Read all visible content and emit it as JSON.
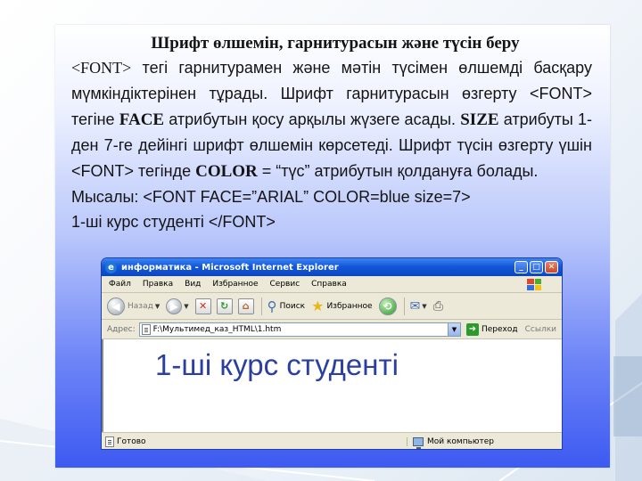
{
  "slide": {
    "title": "Шрифт өлшемін, гарнитурасын және түсін беру",
    "para_parts": [
      "<FONT>",
      " тегі гарнитурамен  және мәтін  түсімен  өлшемді басқару мүмкіндіктерінен  тұрады.  Шрифт  гарнитурасын өзгерту  <FONT>  тегіне ",
      "FACE",
      "  атрибутын  қосу  арқылы жүзеге  асады. ",
      "SIZE",
      "  атрибуты 1-ден  7-ге  дейінгі  шрифт өлшемін  көрсетеді.  Шрифт  түсін  өзгерту  үшін <FONT> тегінде ",
      "COLOR",
      " = “түс” атрибутын қолдануға болады."
    ],
    "example_line": "Мысалы: <FONT FACE=”ARIAL”   COLOR=blue size=7>",
    "example_line2": "1-ші курс студенті   </FONT>"
  },
  "browser": {
    "title": "информатика - Microsoft Internet Explorer",
    "menu": [
      "Файл",
      "Правка",
      "Вид",
      "Избранное",
      "Сервис",
      "Справка"
    ],
    "toolbar": {
      "back": "Назад",
      "search": "Поиск",
      "favorites": "Избранное"
    },
    "address": {
      "label": "Адрес:",
      "value": "F:\\Мультимед_каз_HTML\\1.htm",
      "go": "Переход",
      "links": "Ссылки"
    },
    "page_text": "1-ші курс студенті",
    "status": {
      "left": "Готово",
      "right": "Мой компьютер"
    }
  },
  "colors": {
    "panel_bottom": "#3d5af2",
    "ie_title": "#0a46c4",
    "page_text": "#2a3fa0"
  },
  "icons": [
    "ie-logo-icon",
    "minimize-icon",
    "maximize-icon",
    "close-icon",
    "windows-flag-icon",
    "back-arrow-icon",
    "forward-arrow-icon",
    "stop-icon",
    "refresh-icon",
    "home-icon",
    "search-icon",
    "favorites-star-icon",
    "history-icon",
    "mail-icon",
    "print-icon",
    "page-icon",
    "go-arrow-icon",
    "computer-icon"
  ]
}
